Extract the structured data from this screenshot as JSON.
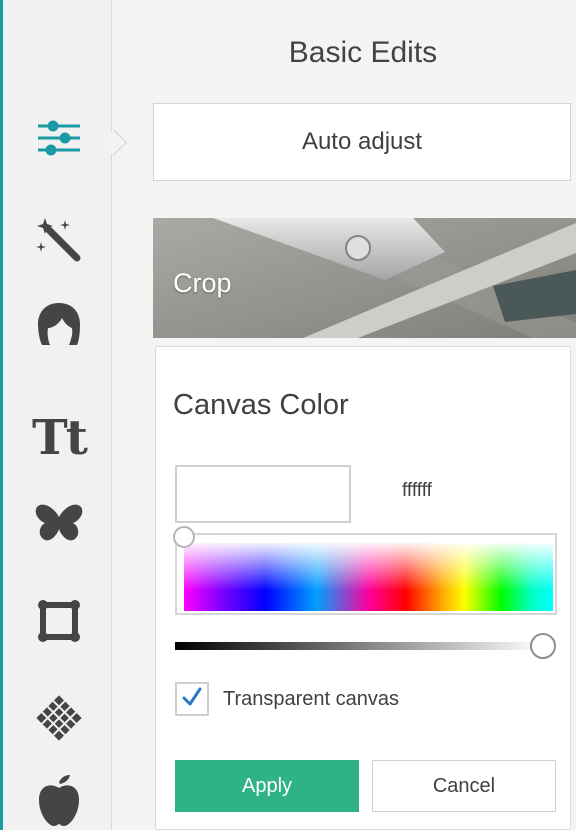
{
  "sidebar": {
    "tools": [
      {
        "icon": "sliders-icon",
        "active": true
      },
      {
        "icon": "magic-wand-icon"
      },
      {
        "icon": "touch-up-face-icon"
      },
      {
        "icon": "text-icon",
        "glyph": "Tt"
      },
      {
        "icon": "butterfly-icon"
      },
      {
        "icon": "frame-icon"
      },
      {
        "icon": "texture-icon"
      },
      {
        "icon": "apple-icon"
      }
    ],
    "active_color": "#1b9aa5"
  },
  "panel": {
    "title": "Basic Edits",
    "auto_adjust_label": "Auto adjust",
    "crop_label": "Crop"
  },
  "canvas_color": {
    "title": "Canvas Color",
    "hex_value": "ffffff",
    "swatch_color": "#ffffff",
    "brightness_level": 1.0,
    "hue_position": 0.0,
    "transparent_checked": true,
    "transparent_label": "Transparent canvas",
    "apply_label": "Apply",
    "cancel_label": "Cancel",
    "apply_color": "#2fb385"
  }
}
